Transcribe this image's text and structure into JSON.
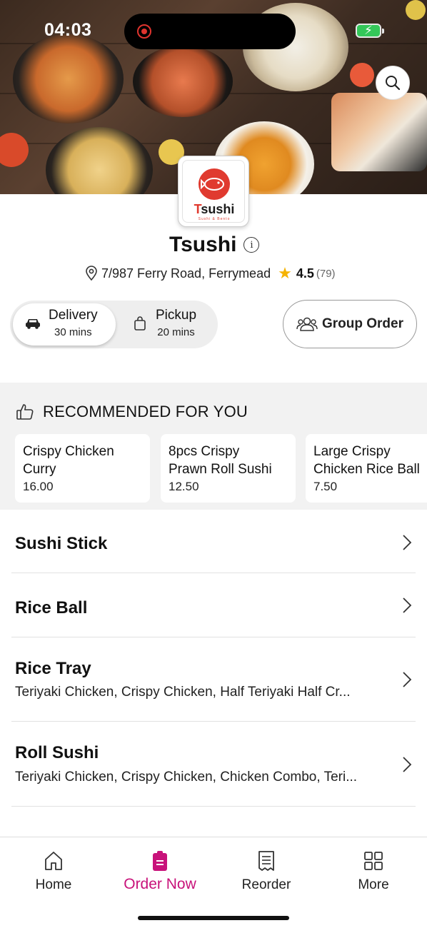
{
  "status_bar": {
    "time": "04:03"
  },
  "store": {
    "name": "Tsushi",
    "logo_text_first": "T",
    "logo_text_rest": "sushi",
    "logo_tagline": "Sushi & Bento",
    "address": "7/987 Ferry Road, Ferrymead",
    "rating": "4.5",
    "rating_count": "(79)"
  },
  "order_modes": [
    {
      "label": "Delivery",
      "time": "30 mins",
      "active": true
    },
    {
      "label": "Pickup",
      "time": "20 mins",
      "active": false
    }
  ],
  "group_order": {
    "label": "Group Order"
  },
  "recommended": {
    "title": "RECOMMENDED FOR YOU",
    "items": [
      {
        "name": "Crispy Chicken\nCurry",
        "price": "16.00"
      },
      {
        "name": "8pcs Crispy\nPrawn Roll Sushi",
        "price": "12.50"
      },
      {
        "name": "Large Crispy\nChicken Rice Ball",
        "price": "7.50"
      }
    ]
  },
  "categories": [
    {
      "name": "Sushi Stick",
      "description": ""
    },
    {
      "name": "Rice Ball",
      "description": ""
    },
    {
      "name": "Rice Tray",
      "description": "Teriyaki Chicken, Crispy Chicken, Half Teriyaki Half Cr..."
    },
    {
      "name": "Roll Sushi",
      "description": "Teriyaki Chicken, Crispy Chicken, Chicken Combo, Teri..."
    }
  ],
  "bottom_nav": {
    "items": [
      {
        "label": "Home",
        "icon": "home-icon",
        "active": false
      },
      {
        "label": "Order Now",
        "icon": "order-icon",
        "active": true
      },
      {
        "label": "Reorder",
        "icon": "receipt-icon",
        "active": false
      },
      {
        "label": "More",
        "icon": "grid-icon",
        "active": false
      }
    ]
  },
  "colors": {
    "accent": "#c8127a",
    "brand_red": "#e03a2f",
    "star": "#f5b301"
  }
}
